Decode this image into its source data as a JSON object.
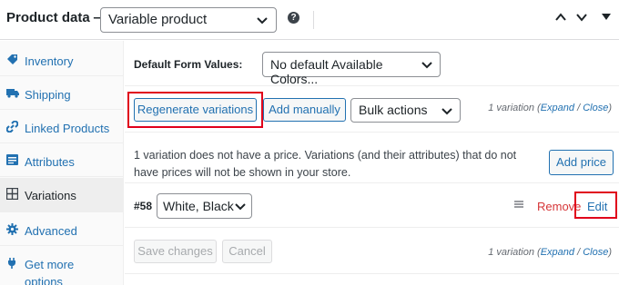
{
  "header": {
    "title": "Product data —",
    "product_type": "Variable product",
    "help": "?"
  },
  "sidebar": {
    "items": [
      {
        "label": "Inventory",
        "icon": "inventory-icon"
      },
      {
        "label": "Shipping",
        "icon": "truck-icon"
      },
      {
        "label": "Linked Products",
        "icon": "link-icon"
      },
      {
        "label": "Attributes",
        "icon": "list-icon"
      },
      {
        "label": "Variations",
        "icon": "grid-icon",
        "active": true
      },
      {
        "label": "Advanced",
        "icon": "gear-icon"
      },
      {
        "label": "Get more options",
        "icon": "plug-icon"
      }
    ]
  },
  "main": {
    "default_form_label": "Default Form Values:",
    "default_form_value": "No default Available Colors...",
    "regenerate_label": "Regenerate variations",
    "add_manually_label": "Add manually",
    "bulk_actions_value": "Bulk actions",
    "variation_count": "1 variation (",
    "expand_label": "Expand",
    "slash": " / ",
    "close_label": "Close",
    "close_paren": ")",
    "notice": "1 variation does not have a price. Variations (and their attributes) that do not have prices will not be shown in your store.",
    "add_price_label": "Add price",
    "variation": {
      "id": "#58",
      "attribute_value": "White, Black,",
      "remove_label": "Remove",
      "edit_label": "Edit"
    },
    "save_changes_label": "Save changes",
    "cancel_label": "Cancel"
  },
  "colors": {
    "accent": "#2271b1",
    "danger": "#d63638",
    "highlight": "#e0001b"
  }
}
